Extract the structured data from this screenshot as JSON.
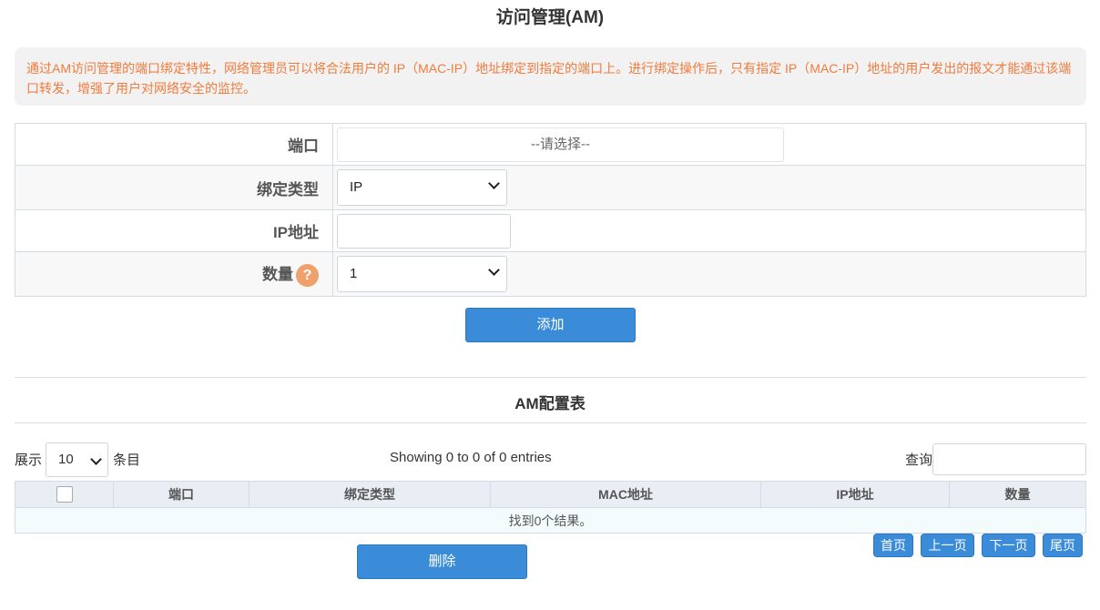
{
  "page": {
    "title": "访问管理(AM)"
  },
  "notice": {
    "text": "通过AM访问管理的端口绑定特性，网络管理员可以将合法用户的 IP（MAC-IP）地址绑定到指定的端口上。进行绑定操作后，只有指定 IP（MAC-IP）地址的用户发出的报文才能通过该端口转发，增强了用户对网络安全的监控。"
  },
  "form": {
    "port_label": "端口",
    "port_placeholder": "--请选择--",
    "bind_type_label": "绑定类型",
    "bind_type_value": "IP",
    "ip_label": "IP地址",
    "ip_value": "",
    "count_label": "数量",
    "count_help": "?",
    "count_value": "1",
    "add_button": "添加"
  },
  "table_section": {
    "title": "AM配置表",
    "show_label": "展示",
    "page_length": "10",
    "entries_label": "条目",
    "info": "Showing 0 to 0 of 0 entries",
    "search_label": "查询",
    "search_value": "",
    "columns": [
      "端口",
      "绑定类型",
      "MAC地址",
      "IP地址",
      "数量"
    ],
    "empty_text": "找到0个结果。",
    "delete_button": "删除",
    "pagination": {
      "first": "首页",
      "prev": "上一页",
      "next": "下一页",
      "last": "尾页"
    }
  },
  "colors": {
    "accent": "#3a8bd8",
    "notice_text": "#f07c3c",
    "help_icon": "#f0a06a"
  }
}
